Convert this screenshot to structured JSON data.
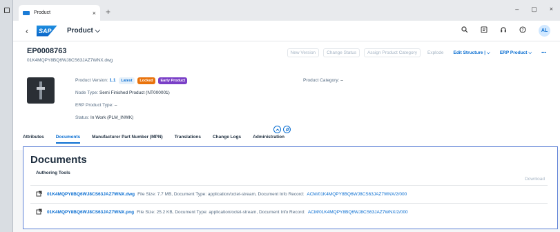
{
  "browser": {
    "tab_title": "Product",
    "tab_close": "×",
    "new_tab": "+",
    "minimize": "–",
    "maximize": "▢",
    "close": "×"
  },
  "shell": {
    "back": "‹",
    "logo_text": "SAP",
    "app_title": "Product ⌵",
    "avatar": "AL"
  },
  "header": {
    "object_id": "EP0008763",
    "object_subtitle": "01K4MQPY8BQ6WJ8CS63JAZ7WNX.dwg",
    "actions": {
      "new_version": "New Version",
      "change_status": "Change Status",
      "assign_category": "Assign Product Category",
      "explode": "Explode",
      "edit_structure": "Edit Structure | ⌵",
      "erp_product": "ERP Product ⌵",
      "more": "•••"
    },
    "fields": {
      "version_label": "Product Version:",
      "version_value": "1.1",
      "badge_latest": "Latest",
      "badge_locked": "Locked",
      "badge_early": "Early Product",
      "node_type_label": "Node Type:",
      "node_type_value": "Semi Finished Product (NT000001)",
      "erp_type_label": "ERP Product Type:",
      "erp_type_value": "–",
      "status_label": "Status:",
      "status_value": "In Work (PLM_INWK)",
      "category_label": "Product Category:",
      "category_value": "–"
    }
  },
  "tabs": [
    "Attributes",
    "Documents",
    "Manufacturer Part Number (MPN)",
    "Translations",
    "Change Logs",
    "Administration"
  ],
  "documents": {
    "title": "Documents",
    "section": "Authoring Tools",
    "download": "Download",
    "rows": [
      {
        "name": "01K4MQPY8BQ6WJ8CS63JAZ7WNX.dwg",
        "meta": "File Size: 7.7 MB, Document Type: application/octet-stream, Document Info Record:",
        "record": "ACM/01K4MQPY8BQ6WJ8CS63JAZ7WNX/2/000"
      },
      {
        "name": "01K4MQPY8BQ6WJ8CS63JAZ7WNX.png",
        "meta": "File Size: 25.2 KB, Document Type: application/octet-stream, Document Info Record:",
        "record": "ACM/01K4MQPY8BQ6WJ8CS63JAZ7WNX/2/000"
      }
    ]
  }
}
